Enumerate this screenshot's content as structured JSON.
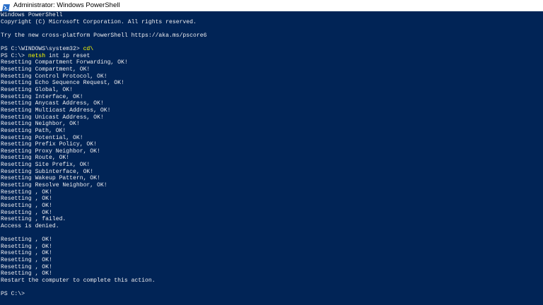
{
  "window": {
    "title": "Administrator: Windows PowerShell",
    "icon": "powershell-icon",
    "background_color": "#012456",
    "text_color": "#eeedf0",
    "command_color": "#ffff00"
  },
  "console": {
    "lines": [
      {
        "kind": "out",
        "text": "Windows PowerShell"
      },
      {
        "kind": "out",
        "text": "Copyright (C) Microsoft Corporation. All rights reserved."
      },
      {
        "kind": "out",
        "text": ""
      },
      {
        "kind": "out",
        "text": "Try the new cross-platform PowerShell https://aka.ms/pscore6"
      },
      {
        "kind": "out",
        "text": ""
      },
      {
        "kind": "cmd",
        "prompt": "PS C:\\WINDOWS\\system32> ",
        "command": "cd\\",
        "args": ""
      },
      {
        "kind": "cmd",
        "prompt": "PS C:\\> ",
        "command": "netsh",
        "args": " int ip reset"
      },
      {
        "kind": "out",
        "text": "Resetting Compartment Forwarding, OK!"
      },
      {
        "kind": "out",
        "text": "Resetting Compartment, OK!"
      },
      {
        "kind": "out",
        "text": "Resetting Control Protocol, OK!"
      },
      {
        "kind": "out",
        "text": "Resetting Echo Sequence Request, OK!"
      },
      {
        "kind": "out",
        "text": "Resetting Global, OK!"
      },
      {
        "kind": "out",
        "text": "Resetting Interface, OK!"
      },
      {
        "kind": "out",
        "text": "Resetting Anycast Address, OK!"
      },
      {
        "kind": "out",
        "text": "Resetting Multicast Address, OK!"
      },
      {
        "kind": "out",
        "text": "Resetting Unicast Address, OK!"
      },
      {
        "kind": "out",
        "text": "Resetting Neighbor, OK!"
      },
      {
        "kind": "out",
        "text": "Resetting Path, OK!"
      },
      {
        "kind": "out",
        "text": "Resetting Potential, OK!"
      },
      {
        "kind": "out",
        "text": "Resetting Prefix Policy, OK!"
      },
      {
        "kind": "out",
        "text": "Resetting Proxy Neighbor, OK!"
      },
      {
        "kind": "out",
        "text": "Resetting Route, OK!"
      },
      {
        "kind": "out",
        "text": "Resetting Site Prefix, OK!"
      },
      {
        "kind": "out",
        "text": "Resetting Subinterface, OK!"
      },
      {
        "kind": "out",
        "text": "Resetting Wakeup Pattern, OK!"
      },
      {
        "kind": "out",
        "text": "Resetting Resolve Neighbor, OK!"
      },
      {
        "kind": "out",
        "text": "Resetting , OK!"
      },
      {
        "kind": "out",
        "text": "Resetting , OK!"
      },
      {
        "kind": "out",
        "text": "Resetting , OK!"
      },
      {
        "kind": "out",
        "text": "Resetting , OK!"
      },
      {
        "kind": "out",
        "text": "Resetting , failed."
      },
      {
        "kind": "out",
        "text": "Access is denied."
      },
      {
        "kind": "out",
        "text": ""
      },
      {
        "kind": "out",
        "text": "Resetting , OK!"
      },
      {
        "kind": "out",
        "text": "Resetting , OK!"
      },
      {
        "kind": "out",
        "text": "Resetting , OK!"
      },
      {
        "kind": "out",
        "text": "Resetting , OK!"
      },
      {
        "kind": "out",
        "text": "Resetting , OK!"
      },
      {
        "kind": "out",
        "text": "Resetting , OK!"
      },
      {
        "kind": "out",
        "text": "Restart the computer to complete this action."
      },
      {
        "kind": "out",
        "text": ""
      },
      {
        "kind": "cmd",
        "prompt": "PS C:\\>",
        "command": "",
        "args": ""
      }
    ]
  }
}
